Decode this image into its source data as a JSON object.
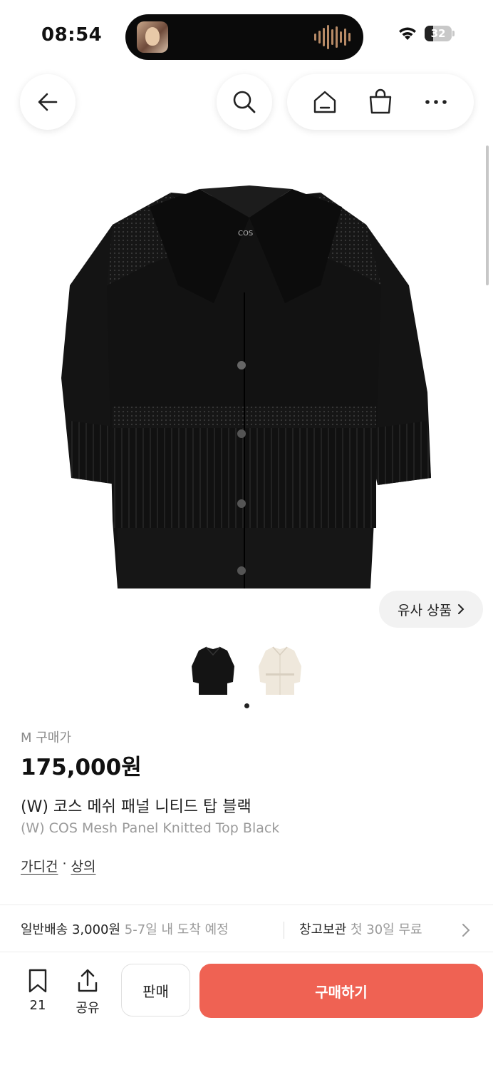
{
  "status_bar": {
    "time": "08:54",
    "battery": "32"
  },
  "gallery": {
    "similar_label": "유사 상품",
    "active_index": 0,
    "thumbnail_count": 2
  },
  "product": {
    "size_label": "M 구매가",
    "price": "175,000원",
    "name_ko": "(W) 코스 메쉬 패널 니티드 탑 블랙",
    "name_en": "(W) COS Mesh Panel Knitted Top Black",
    "categories": [
      "가디건",
      "상의"
    ],
    "category_separator": "·",
    "image_brand_tag": "COS"
  },
  "shipping": {
    "standard_label": "일반배송 3,000원",
    "standard_eta": "5-7일 내 도착 예정",
    "storage_label": "창고보관",
    "storage_note": "첫 30일 무료"
  },
  "bottom_bar": {
    "bookmark_count": "21",
    "share_label": "공유",
    "sell_label": "판매",
    "buy_label": "구매하기"
  },
  "colors": {
    "buy_button": "#ef6253",
    "text_gray": "#9a9a9a"
  }
}
